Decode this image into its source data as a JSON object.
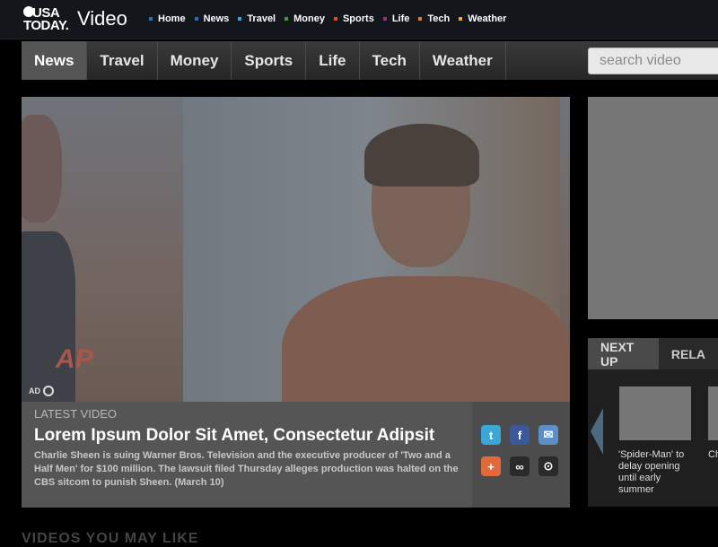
{
  "header": {
    "logo_line1": "USA",
    "logo_line2": "TODAY.",
    "title": "Video",
    "nav": [
      {
        "label": "Home",
        "color": "#2a6db8"
      },
      {
        "label": "News",
        "color": "#2a6db8"
      },
      {
        "label": "Travel",
        "color": "#3ba0d8"
      },
      {
        "label": "Money",
        "color": "#3f9a3f"
      },
      {
        "label": "Sports",
        "color": "#d94a2a"
      },
      {
        "label": "Life",
        "color": "#8a3b7a"
      },
      {
        "label": "Tech",
        "color": "#e07a2a"
      },
      {
        "label": "Weather",
        "color": "#e0b02a"
      }
    ]
  },
  "tabs": [
    "News",
    "Travel",
    "Money",
    "Sports",
    "Life",
    "Tech",
    "Weather"
  ],
  "active_tab": "News",
  "search": {
    "placeholder": "search video"
  },
  "player": {
    "ap_text": "AP",
    "ad_badge": "AD"
  },
  "info": {
    "latest_label": "LATEST VIDEO",
    "headline": "Lorem Ipsum Dolor Sit Amet, Consectetur Adipsit",
    "description": "Charlie Sheen is suing Warner Bros. Television and the executive producer of 'Two and a Half Men' for $100 million. The lawsuit filed Thursday alleges production was halted on the CBS sitcom to punish Sheen. (March 10)"
  },
  "share_icons": [
    {
      "name": "twitter-icon",
      "glyph": "t",
      "color": "#3ba6d8"
    },
    {
      "name": "facebook-icon",
      "glyph": "f",
      "color": "#3b5998"
    },
    {
      "name": "email-icon",
      "glyph": "✉",
      "color": "#5a8fc8"
    },
    {
      "name": "add-icon",
      "glyph": "+",
      "color": "#e06a3a"
    },
    {
      "name": "link-icon",
      "glyph": "∞",
      "color": "#2a2a2a"
    },
    {
      "name": "embed-icon",
      "glyph": "⊙",
      "color": "#2a2a2a"
    }
  ],
  "upnext": {
    "tabs": [
      "NEXT UP",
      "RELA"
    ],
    "items": [
      {
        "caption": "'Spider-Man' to delay opening until early summer"
      },
      {
        "caption": "Ch La Ea do"
      }
    ]
  },
  "bottom_heading": "VIDEOS YOU MAY LIKE"
}
